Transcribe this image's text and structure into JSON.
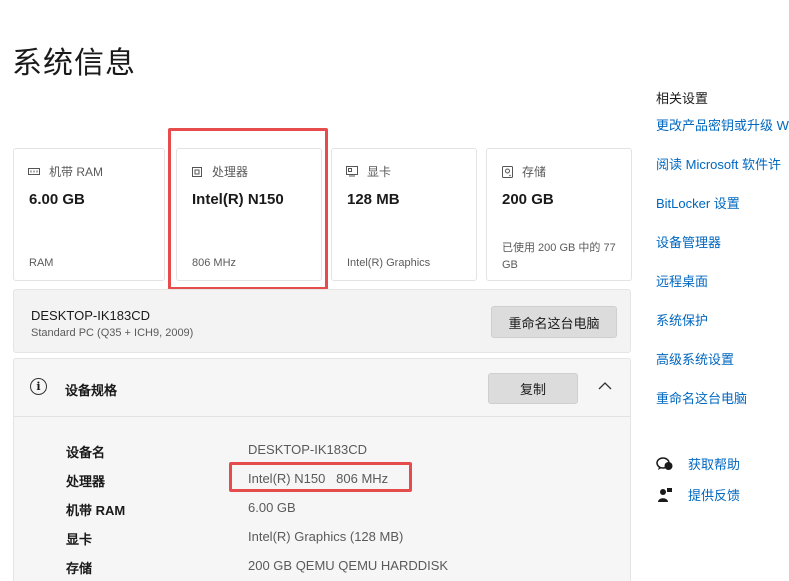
{
  "page_title": "系统信息",
  "cards": [
    {
      "icon": "ram-icon",
      "label": "机带 RAM",
      "value": "6.00 GB",
      "sub": "RAM"
    },
    {
      "icon": "processor-icon",
      "label": "处理器",
      "value": "Intel(R) N150",
      "sub": "806 MHz"
    },
    {
      "icon": "display-icon",
      "label": "显卡",
      "value": "128 MB",
      "sub": "Intel(R) Graphics"
    },
    {
      "icon": "storage-icon",
      "label": "存储",
      "value": "200 GB",
      "sub": "已使用 200 GB 中的 77 GB"
    }
  ],
  "device": {
    "name": "DESKTOP-IK183CD",
    "model": "Standard PC (Q35 + ICH9, 2009)",
    "rename_button": "重命名这台电脑"
  },
  "specs": {
    "title": "设备规格",
    "copy_button": "复制",
    "rows": [
      {
        "label": "设备名",
        "value": "DESKTOP-IK183CD"
      },
      {
        "label": "处理器",
        "value": "Intel(R) N150   806 MHz"
      },
      {
        "label": "机带 RAM",
        "value": "6.00 GB"
      },
      {
        "label": "显卡",
        "value": "Intel(R) Graphics (128 MB)"
      },
      {
        "label": "存储",
        "value": "200 GB QEMU QEMU HARDDISK"
      }
    ]
  },
  "sidebar": {
    "title": "相关设置",
    "links": [
      "更改产品密钥或升级 W",
      "阅读 Microsoft 软件许",
      "BitLocker 设置",
      "设备管理器",
      "远程桌面",
      "系统保护",
      "高级系统设置",
      "重命名这台电脑"
    ],
    "help": "获取帮助",
    "feedback": "提供反馈"
  },
  "colors": {
    "accent": "#0067c0",
    "highlight": "#e74c4c"
  }
}
